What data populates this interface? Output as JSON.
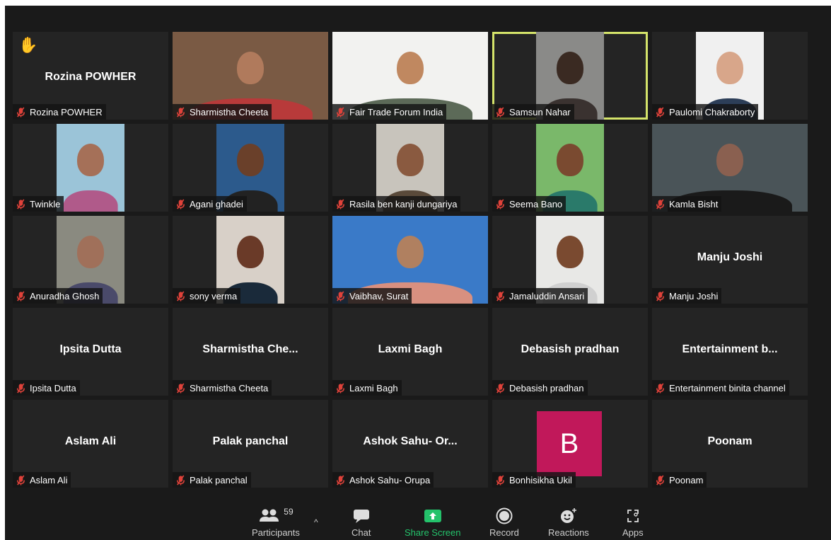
{
  "participants": [
    {
      "center_name": "Rozina POWHER",
      "label": "Rozina POWHER",
      "type": "name",
      "hand": true
    },
    {
      "label": "Sharmistha Cheeta",
      "type": "video",
      "video": "wide",
      "bg": "#7a5a44",
      "skin": "#b07a5c",
      "shirt": "#b83a3a"
    },
    {
      "label": "Fair Trade Forum India",
      "type": "video",
      "video": "wide",
      "bg": "#f2f2f0",
      "skin": "#c08860",
      "shirt": "#5c6a58"
    },
    {
      "label": "Samsun Nahar",
      "type": "video",
      "video": "narrow",
      "bg": "#8a8a88",
      "skin": "#3a2a22",
      "shirt": "#3a3230",
      "active": true
    },
    {
      "label": "Paulomi Chakraborty",
      "type": "video",
      "video": "narrow",
      "bg": "#f0f0f0",
      "skin": "#d8a68a",
      "shirt": "#2c3e58"
    },
    {
      "label": "Twinkle",
      "type": "video",
      "video": "narrow",
      "bg": "#9bc4d8",
      "skin": "#a57058",
      "shirt": "#b05a8a"
    },
    {
      "label": "Agani ghadei",
      "type": "video",
      "video": "narrow",
      "bg": "#2c5a8c",
      "skin": "#6a402a",
      "shirt": "#222"
    },
    {
      "label": "Rasila ben kanji dungariya",
      "type": "video",
      "video": "narrow",
      "bg": "#c8c4bc",
      "skin": "#8a5a40",
      "shirt": "#5a4a3a"
    },
    {
      "label": "Seema Bano",
      "type": "video",
      "video": "narrow",
      "bg": "#7ab86a",
      "skin": "#7a4a30",
      "shirt": "#2a7a6a"
    },
    {
      "label": "Kamla Bisht",
      "type": "video",
      "video": "wide",
      "bg": "#4a5458",
      "skin": "#8a6050",
      "shirt": "#1a1a1a"
    },
    {
      "label": "Anuradha Ghosh",
      "type": "video",
      "video": "narrow",
      "bg": "#8a8a80",
      "skin": "#a0705a",
      "shirt": "#4a4a6a"
    },
    {
      "label": "sony verma",
      "type": "video",
      "video": "narrow",
      "bg": "#d8d0c8",
      "skin": "#6a3a28",
      "shirt": "#1a2a3a"
    },
    {
      "label": "Vaibhav, Surat",
      "type": "video",
      "video": "wide",
      "bg": "#3a7ac8",
      "skin": "#b08060",
      "shirt": "#d89080"
    },
    {
      "label": "Jamaluddin Ansari",
      "type": "video",
      "video": "narrow",
      "bg": "#e8e8e6",
      "skin": "#7a4a30",
      "shirt": "#d0d0d0"
    },
    {
      "center_name": "Manju Joshi",
      "label": "Manju Joshi",
      "type": "name"
    },
    {
      "center_name": "Ipsita Dutta",
      "label": "Ipsita Dutta",
      "type": "name"
    },
    {
      "center_name": "Sharmistha  Che...",
      "label": "Sharmistha Cheeta",
      "type": "name"
    },
    {
      "center_name": "Laxmi Bagh",
      "label": "Laxmi Bagh",
      "type": "name"
    },
    {
      "center_name": "Debasish pradhan",
      "label": "Debasish pradhan",
      "type": "name"
    },
    {
      "center_name": "Entertainment  b...",
      "label": "Entertainment binita channel",
      "type": "name"
    },
    {
      "center_name": "Aslam Ali",
      "label": "Aslam Ali",
      "type": "name"
    },
    {
      "center_name": "Palak panchal",
      "label": "Palak panchal",
      "type": "name"
    },
    {
      "center_name": "Ashok Sahu- Or...",
      "label": "Ashok Sahu- Orupa",
      "type": "name"
    },
    {
      "label": "Bonhisikha Ukil",
      "type": "avatar",
      "avatar_letter": "B",
      "avatar_color": "#c1185a"
    },
    {
      "center_name": "Poonam",
      "label": "Poonam",
      "type": "name"
    }
  ],
  "toolbar": {
    "participants_label": "Participants",
    "participants_count": "59",
    "caret": "^",
    "chat_label": "Chat",
    "share_label": "Share Screen",
    "record_label": "Record",
    "reactions_label": "Reactions",
    "apps_label": "Apps"
  },
  "colors": {
    "background": "#1a1a1a",
    "tile": "#242424",
    "active_border": "#d4e36a",
    "muted_mic": "#e0423a",
    "share_green": "#24c26b",
    "raise_hand": "#f5b51b"
  }
}
